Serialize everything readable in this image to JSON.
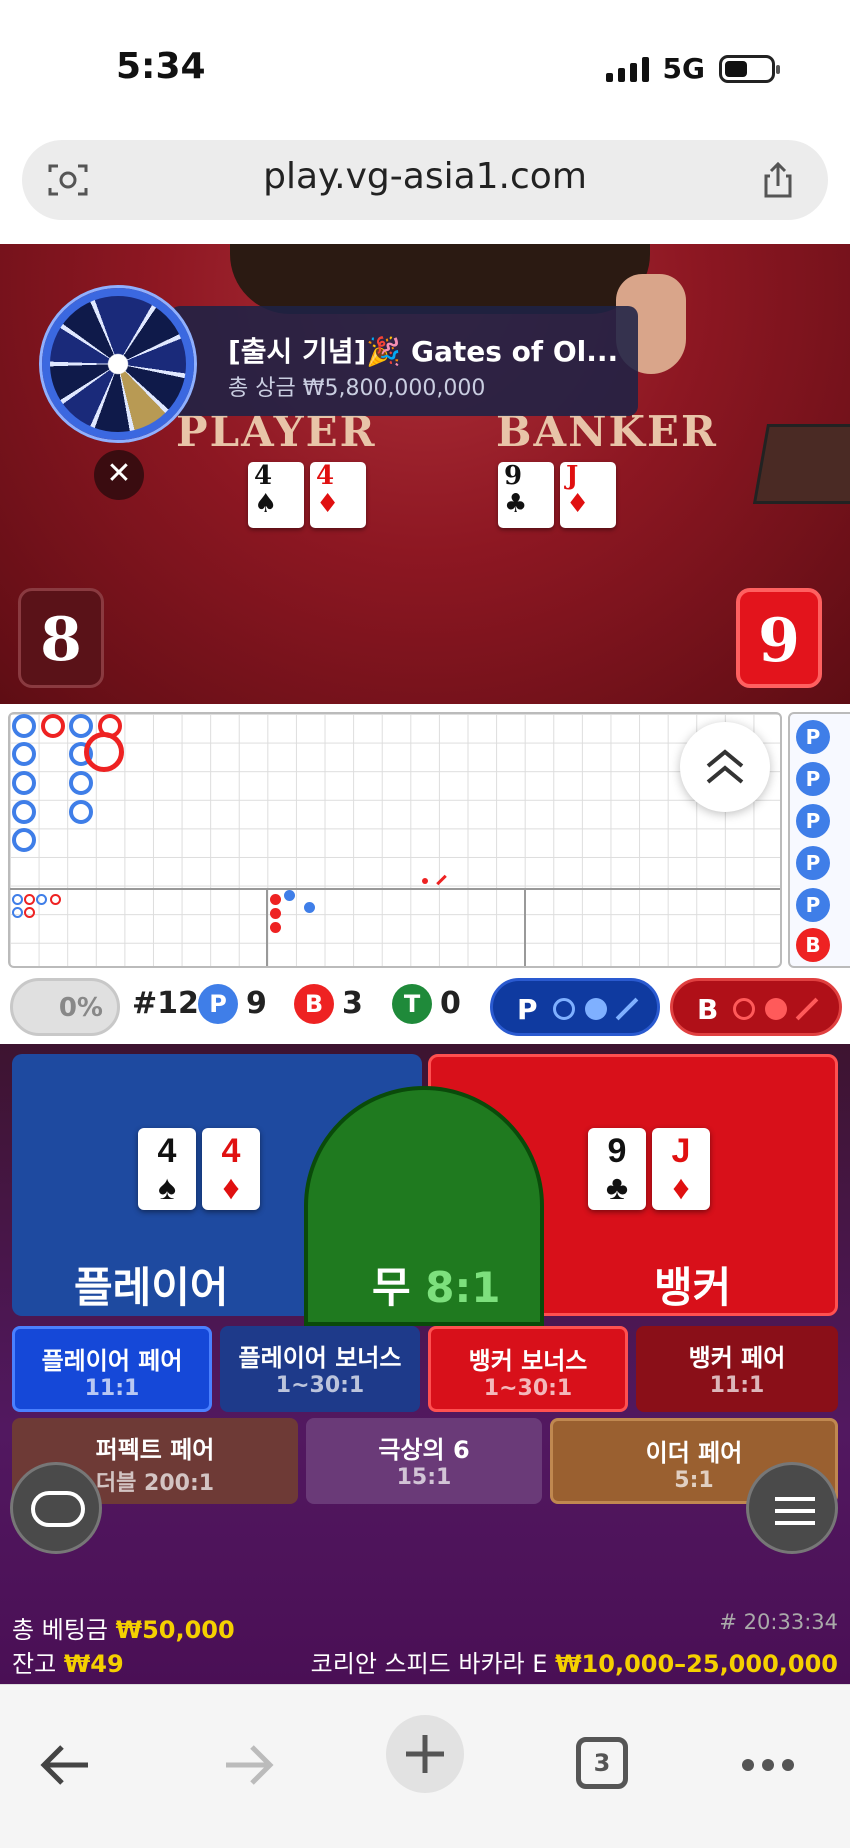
{
  "status_bar": {
    "time": "5:34",
    "network": "5G"
  },
  "browser": {
    "url": "play.vg-asia1.com",
    "tab_count": "3"
  },
  "video": {
    "promo_title": "[출시 기념]🎉 Gates of Ol...",
    "promo_prize": "총 상금 ₩5,800,000,000",
    "player_label": "PLAYER",
    "banker_label": "BANKER",
    "player_cards": [
      {
        "rank": "4",
        "suit": "♠",
        "color": "#111"
      },
      {
        "rank": "4",
        "suit": "♦",
        "color": "#e01010"
      }
    ],
    "banker_cards": [
      {
        "rank": "9",
        "suit": "♣",
        "color": "#111"
      },
      {
        "rank": "J",
        "suit": "♦",
        "color": "#e01010"
      }
    ],
    "player_score": "8",
    "banker_score": "9"
  },
  "stats": {
    "toggle_percent": "0%",
    "round": "#12",
    "player_count": "9",
    "banker_count": "3",
    "tie_count": "0",
    "p_chip": "P",
    "b_chip": "B",
    "t_chip": "T",
    "predict_player": "P",
    "predict_banker": "B"
  },
  "sideroad": {
    "labels": [
      "P",
      "P",
      "P",
      "P",
      "P",
      "B"
    ]
  },
  "betting": {
    "player_label": "플레이어",
    "tie_label": "무",
    "tie_odds": "8:1",
    "banker_label": "뱅커",
    "side_bets": [
      {
        "name": "플레이어 페어",
        "odds": "11:1"
      },
      {
        "name": "플레이어 보너스",
        "odds": "1~30:1"
      },
      {
        "name": "뱅커 보너스",
        "odds": "1~30:1"
      },
      {
        "name": "뱅커 페어",
        "odds": "11:1"
      },
      {
        "name": "퍼펙트 페어",
        "odds": "더블 200:1"
      },
      {
        "name": "극상의 6",
        "odds": "15:1"
      },
      {
        "name": "이더 페어",
        "odds": "5:1"
      }
    ]
  },
  "footer": {
    "total_bet_label": "총 베팅금",
    "total_bet_value": "₩50,000",
    "balance_label": "잔고",
    "balance_value": "₩49",
    "round_id": "# 20:33:34",
    "table_name": "코리안 스피드 바카라 E",
    "limits": "₩10,000–25,000,000"
  },
  "colors": {
    "player_blue": "#1e4aa0",
    "banker_red": "#d8101a",
    "tie_green": "#1f7a1f",
    "highlight_yellow": "#f5d000"
  },
  "icons": [
    "scan-icon",
    "share-icon",
    "close-icon",
    "chevron-up-double-icon",
    "chat-icon",
    "menu-icon",
    "back-icon",
    "forward-icon",
    "new-tab-icon",
    "tabs-icon",
    "more-icon"
  ]
}
